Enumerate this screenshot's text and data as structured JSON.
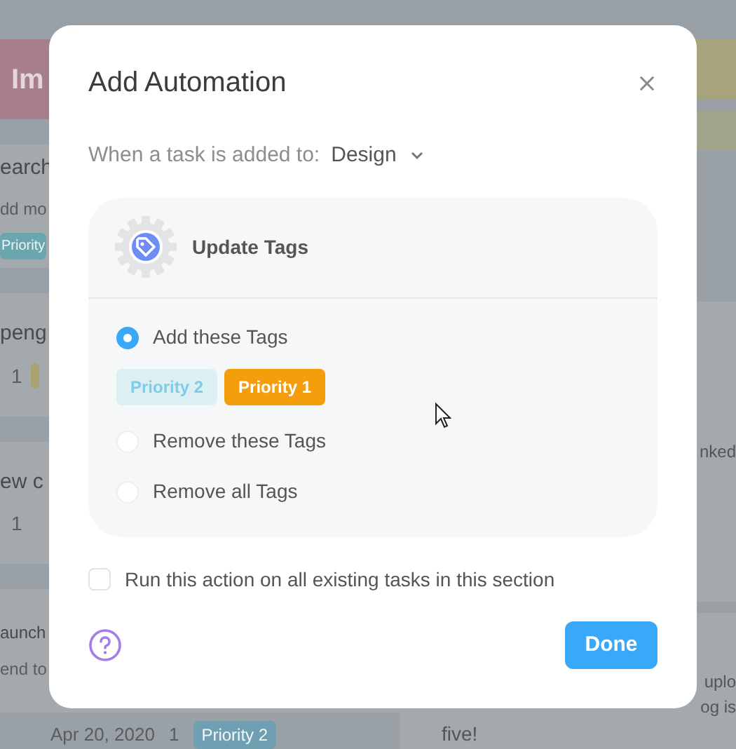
{
  "background": {
    "left_header": "Im",
    "left_cards": [
      {
        "lines": [
          "earch",
          "dd mo"
        ],
        "tags": [
          {
            "label": "Priority",
            "color": "#6aa6ae"
          }
        ]
      },
      {
        "lines": [
          "peng"
        ],
        "count": "1",
        "tags": [
          {
            "color": "#a8a370"
          }
        ]
      },
      {
        "lines": [
          "ew c"
        ],
        "count": "1"
      },
      {
        "lines": [
          "aunch",
          "end to"
        ]
      }
    ],
    "footer_row": {
      "date": "Apr 20, 2020",
      "count": "1",
      "tag": {
        "label": "Priority 2",
        "color": "#6f9fb0"
      }
    },
    "right_fragments": [
      "nked",
      "uplo",
      "og is"
    ],
    "right_note": "five!"
  },
  "modal": {
    "title": "Add Automation",
    "trigger_label": "When a task is added to:",
    "section": "Design",
    "action": {
      "title": "Update Tags",
      "options": [
        {
          "label": "Add these Tags",
          "selected": true
        },
        {
          "label": "Remove these Tags",
          "selected": false
        },
        {
          "label": "Remove all Tags",
          "selected": false
        }
      ],
      "tags": [
        {
          "label": "Priority 2",
          "color": "#dcf0f4"
        },
        {
          "label": "Priority 1",
          "color": "#f59e0b"
        }
      ]
    },
    "run_existing": {
      "label": "Run this action on all existing tasks in this section",
      "checked": false
    },
    "done": "Done"
  }
}
